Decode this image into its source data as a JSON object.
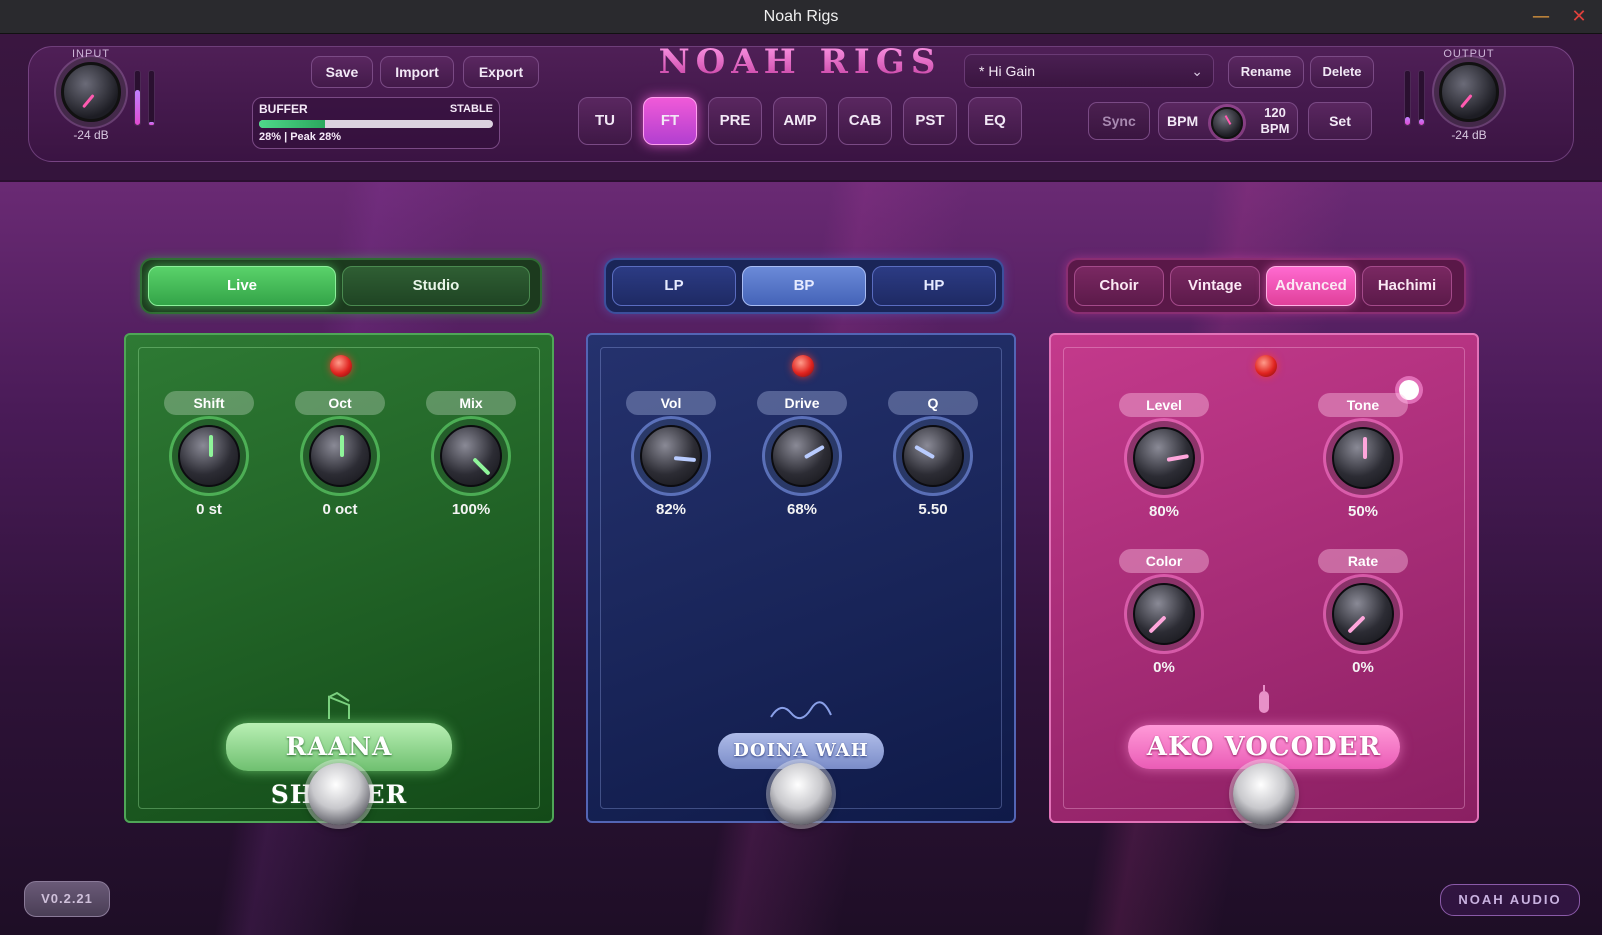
{
  "window": {
    "title": "Noah Rigs",
    "minimize_glyph": "—",
    "close_glyph": "✕"
  },
  "header": {
    "input": {
      "label": "INPUT",
      "value": "-24 dB",
      "meter_level": 0.65
    },
    "output": {
      "label": "OUTPUT",
      "value": "-24 dB",
      "meter_level": 0.15
    },
    "file_buttons": [
      "Save",
      "Import",
      "Export"
    ],
    "buffer": {
      "label": "BUFFER",
      "status": "STABLE",
      "fill": 0.28,
      "peak_text": "28% | Peak 28%"
    },
    "logo": "NOAH RIGS",
    "tabs": [
      {
        "label": "TU",
        "active": false
      },
      {
        "label": "FT",
        "active": true
      },
      {
        "label": "PRE",
        "active": false
      },
      {
        "label": "AMP",
        "active": false
      },
      {
        "label": "CAB",
        "active": false
      },
      {
        "label": "PST",
        "active": false
      },
      {
        "label": "EQ",
        "active": false
      }
    ],
    "preset": {
      "selected": "* Hi Gain"
    },
    "preset_buttons": {
      "rename": "Rename",
      "delete": "Delete"
    },
    "sync_label": "Sync",
    "bpm": {
      "label": "BPM",
      "value_line1": "120",
      "value_line2": "BPM"
    },
    "set_label": "Set"
  },
  "pedals": {
    "green": {
      "modes": [
        {
          "label": "Live",
          "active": true
        },
        {
          "label": "Studio",
          "active": false
        }
      ],
      "controls": [
        {
          "label": "Shift",
          "value": "0 st",
          "angle": 0
        },
        {
          "label": "Oct",
          "value": "0 oct",
          "angle": 0
        },
        {
          "label": "Mix",
          "value": "100%",
          "angle": 135
        }
      ],
      "name": "RAANA SHIFTER"
    },
    "blue": {
      "modes": [
        {
          "label": "LP",
          "active": false
        },
        {
          "label": "BP",
          "active": true
        },
        {
          "label": "HP",
          "active": false
        }
      ],
      "controls": [
        {
          "label": "Vol",
          "value": "82%",
          "angle": 95
        },
        {
          "label": "Drive",
          "value": "68%",
          "angle": 60
        },
        {
          "label": "Q",
          "value": "5.50",
          "angle": -60
        }
      ],
      "name": "DOINA WAH"
    },
    "pink": {
      "modes": [
        {
          "label": "Choir",
          "active": false
        },
        {
          "label": "Vintage",
          "active": false
        },
        {
          "label": "Advanced",
          "active": true
        },
        {
          "label": "Hachimi",
          "active": false
        }
      ],
      "controls": [
        {
          "label": "Level",
          "value": "80%",
          "angle": 80
        },
        {
          "label": "Tone",
          "value": "50%",
          "angle": 0
        },
        {
          "label": "Color",
          "value": "0%",
          "angle": -135
        },
        {
          "label": "Rate",
          "value": "0%",
          "angle": -135
        }
      ],
      "name": "AKO VOCODER"
    }
  },
  "footer": {
    "version": "V0.2.21",
    "brand": "NOAH AUDIO"
  },
  "colors": {
    "accent": "#f05ad8",
    "green": "#5ad26a",
    "blue": "#6b8ad8",
    "pink": "#ff6ad0",
    "led": "#e02420"
  }
}
